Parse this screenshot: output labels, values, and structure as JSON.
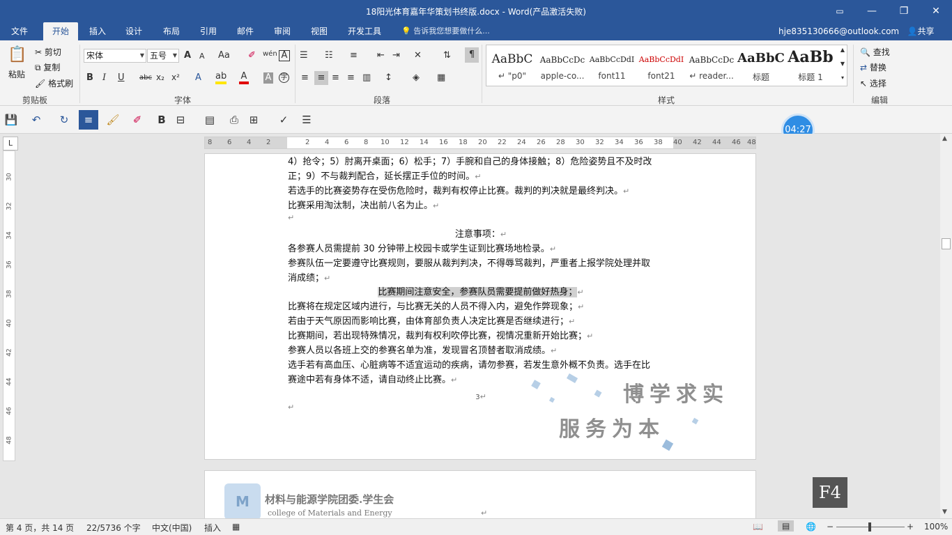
{
  "window": {
    "title": "18阳光体育嘉年华策划书终版.docx - Word(产品激活失败)",
    "restore_icon": "ribbon-display-icon",
    "minimize": "—",
    "maximize": "❐",
    "close": "✕"
  },
  "tabs": [
    {
      "label": "文件"
    },
    {
      "label": "开始"
    },
    {
      "label": "插入"
    },
    {
      "label": "设计"
    },
    {
      "label": "布局"
    },
    {
      "label": "引用"
    },
    {
      "label": "邮件"
    },
    {
      "label": "审阅"
    },
    {
      "label": "视图"
    },
    {
      "label": "开发工具"
    }
  ],
  "tellme": "告诉我您想要做什么...",
  "account": "hje835130666@outlook.com",
  "share": "共享",
  "clipboard": {
    "paste": "粘贴",
    "cut": "剪切",
    "copy": "复制",
    "format_painter": "格式刷",
    "group": "剪贴板"
  },
  "font": {
    "name": "宋体",
    "size": "五号",
    "group": "字体",
    "bold": "B",
    "italic": "I",
    "underline": "U",
    "strike": "abc",
    "sub": "x₂",
    "sup": "x²",
    "grow": "A",
    "shrink": "A",
    "case": "Aa",
    "phonetic": "wén",
    "border": "A"
  },
  "paragraph": {
    "group": "段落"
  },
  "styles": {
    "group": "样式",
    "items": [
      {
        "preview": "AaBbC",
        "name": "↵ \"p0\""
      },
      {
        "preview": "AaBbCcDc",
        "name": "apple-co..."
      },
      {
        "preview": "AaBbCcDdI",
        "name": "font11"
      },
      {
        "preview": "AaBbCcDdI",
        "name": "font21"
      },
      {
        "preview": "AaBbCcDc",
        "name": "↵ reader..."
      },
      {
        "preview": "AaBbC",
        "name": "标题"
      },
      {
        "preview": "AaBb",
        "name": "标题 1"
      }
    ]
  },
  "editing": {
    "group": "编辑",
    "find": "查找",
    "replace": "替换",
    "select": "选择"
  },
  "qat": {
    "bold": "B"
  },
  "colors": {
    "brand": "#2b579a",
    "timer": "#2f8de4",
    "font_red": "#e00000",
    "highlight_yellow": "#ffe600"
  },
  "ruler": {
    "top_numbers": [
      "8",
      "6",
      "4",
      "2",
      "2",
      "4",
      "6",
      "8",
      "10",
      "12",
      "14",
      "16",
      "18",
      "20",
      "22",
      "24",
      "26",
      "28",
      "30",
      "32",
      "34",
      "36",
      "38",
      "40",
      "42",
      "44",
      "46",
      "48"
    ],
    "left_numbers": [
      "30",
      "32",
      "34",
      "36",
      "38",
      "40",
      "42",
      "44",
      "46",
      "48"
    ],
    "corner": "L"
  },
  "document": {
    "lines": [
      {
        "text": "4）抢令；5）肘离开桌面；6）松手；7）手腕和自己的身体接触；8）危险姿势且不及时改",
        "mark": ""
      },
      {
        "text": "正；9）不与裁判配合，延长摆正手位的时间。",
        "mark": "↵"
      },
      {
        "text": "若选手的比赛姿势存在受伤危险时，裁判有权停止比赛。裁判的判决就是最终判决。",
        "mark": "↵"
      },
      {
        "text": "比赛采用淘汰制，决出前八名为止。",
        "mark": "↵"
      },
      {
        "text": "",
        "mark": "↵"
      },
      {
        "text": "注意事项：",
        "mark": "↵"
      },
      {
        "text": "各参赛人员需提前 30 分钟带上校园卡或学生证到比赛场地检录。",
        "mark": "↵"
      },
      {
        "text": "参赛队伍一定要遵守比赛规则，要服从裁判判决，不得辱骂裁判，严重者上报学院处理并取",
        "mark": ""
      },
      {
        "text": "消成绩；",
        "mark": "↵"
      },
      {
        "text": "比赛期间注意安全，参赛队员需要提前做好热身；",
        "mark": "↵"
      },
      {
        "text": "比赛将在规定区域内进行，与比赛无关的人员不得入内，避免作弊现象；",
        "mark": "↵"
      },
      {
        "text": "若由于天气原因而影响比赛，由体育部负责人决定比赛是否继续进行；",
        "mark": "↵"
      },
      {
        "text": "比赛期间，若出现特殊情况，裁判有权利吹停比赛，视情况重新开始比赛；",
        "mark": "↵"
      },
      {
        "text": "参赛人员以各班上交的参赛名单为准，发现冒名顶替者取消成绩。",
        "mark": "↵"
      },
      {
        "text": "选手若有高血压、心脏病等不适宜运动的疾病，请勿参赛，若发生意外概不负责。选手在比",
        "mark": ""
      },
      {
        "text": "赛途中若有身体不适，请自动终止比赛。",
        "mark": "↵"
      }
    ],
    "page_number": "3",
    "end_mark": "↵",
    "watermark_line1": "博学求实",
    "watermark_line2": "服务为本",
    "page2_logo_line1": "材料与能源学院团委.学生会",
    "page2_logo_line2": "college of Materials and Energy",
    "page2_mark": "↵"
  },
  "timer": "04:27",
  "key_overlay": "F4",
  "status": {
    "page": "第 4 页，共 14 页",
    "words": "22/5736 个字",
    "language": "中文(中国)",
    "mode": "插入",
    "zoom": "100%"
  }
}
